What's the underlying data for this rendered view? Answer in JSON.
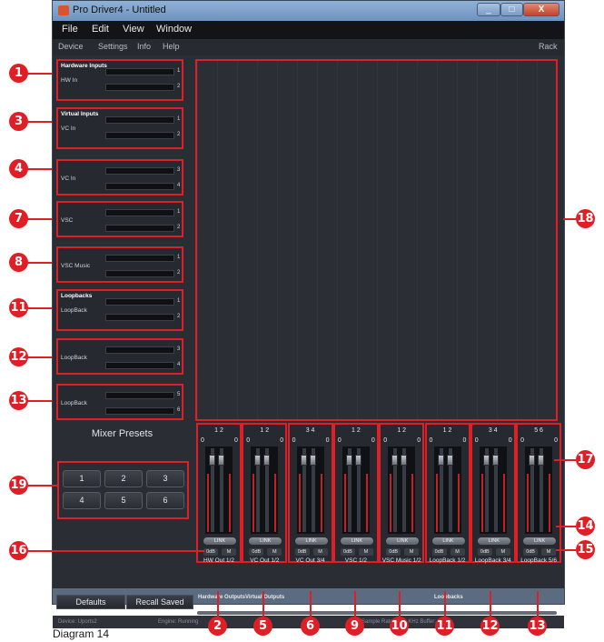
{
  "window": {
    "title": "Pro Driver4 - Untitled",
    "controls": [
      "_",
      "□",
      "X"
    ]
  },
  "menubar": [
    "File",
    "Edit",
    "View",
    "Window"
  ],
  "toolbar": {
    "left": [
      "Device",
      "Settings",
      "Info",
      "Help"
    ],
    "right": "Rack"
  },
  "inputs": [
    {
      "header": "Hardware Inputs",
      "label": "HW In",
      "channels": [
        "1",
        "2"
      ]
    },
    {
      "header": "Virtual Inputs",
      "label": "VC In",
      "channels": [
        "1",
        "2"
      ]
    },
    {
      "header": "",
      "label": "VC In",
      "channels": [
        "3",
        "4"
      ]
    },
    {
      "header": "",
      "label": "VSC",
      "channels": [
        "1",
        "2"
      ]
    },
    {
      "header": "",
      "label": "VSC Music",
      "channels": [
        "1",
        "2"
      ]
    },
    {
      "header": "Loopbacks",
      "label": "LoopBack",
      "channels": [
        "1",
        "2"
      ]
    },
    {
      "header": "",
      "label": "LoopBack",
      "channels": [
        "3",
        "4"
      ]
    },
    {
      "header": "",
      "label": "LoopBack",
      "channels": [
        "5",
        "6"
      ]
    }
  ],
  "mixer_presets": {
    "title": "Mixer Presets",
    "buttons": [
      "1",
      "2",
      "3",
      "4",
      "5",
      "6"
    ]
  },
  "strips": [
    {
      "channels": "1 2",
      "label": "HW Out 1/2"
    },
    {
      "channels": "1 2",
      "label": "VC Out 1/2"
    },
    {
      "channels": "3 4",
      "label": "VC Out 3/4"
    },
    {
      "channels": "1 2",
      "label": "VSC 1/2"
    },
    {
      "channels": "1 2",
      "label": "VSC Music 1/2"
    },
    {
      "channels": "1 2",
      "label": "LoopBack 1/2"
    },
    {
      "channels": "3 4",
      "label": "LoopBack 3/4"
    },
    {
      "channels": "5 6",
      "label": "LoopBack 5/6"
    }
  ],
  "strip_common": {
    "zero_left": "0",
    "zero_right": "0",
    "link": "LINK",
    "db": "0dB",
    "mute": "M"
  },
  "bottom": {
    "defaults": "Defaults",
    "recall": "Recall Saved",
    "sections": [
      "Hardware Outputs",
      "Virtual Outputs",
      "Loopbacks"
    ]
  },
  "status": {
    "device": "Device: Uports2",
    "engine": "Engine: Running",
    "rate": "Sample Rate: 44.1 KHz  Buffer: 64"
  },
  "callouts": [
    "1",
    "3",
    "4",
    "7",
    "8",
    "11",
    "12",
    "13",
    "16",
    "19",
    "18",
    "17",
    "14",
    "15",
    "2",
    "5",
    "6",
    "9",
    "10",
    "11",
    "12",
    "13"
  ],
  "caption": "Diagram 14",
  "colors": {
    "callout": "#e01e25",
    "panel": "#2a2d34",
    "menubar": "#121418"
  }
}
